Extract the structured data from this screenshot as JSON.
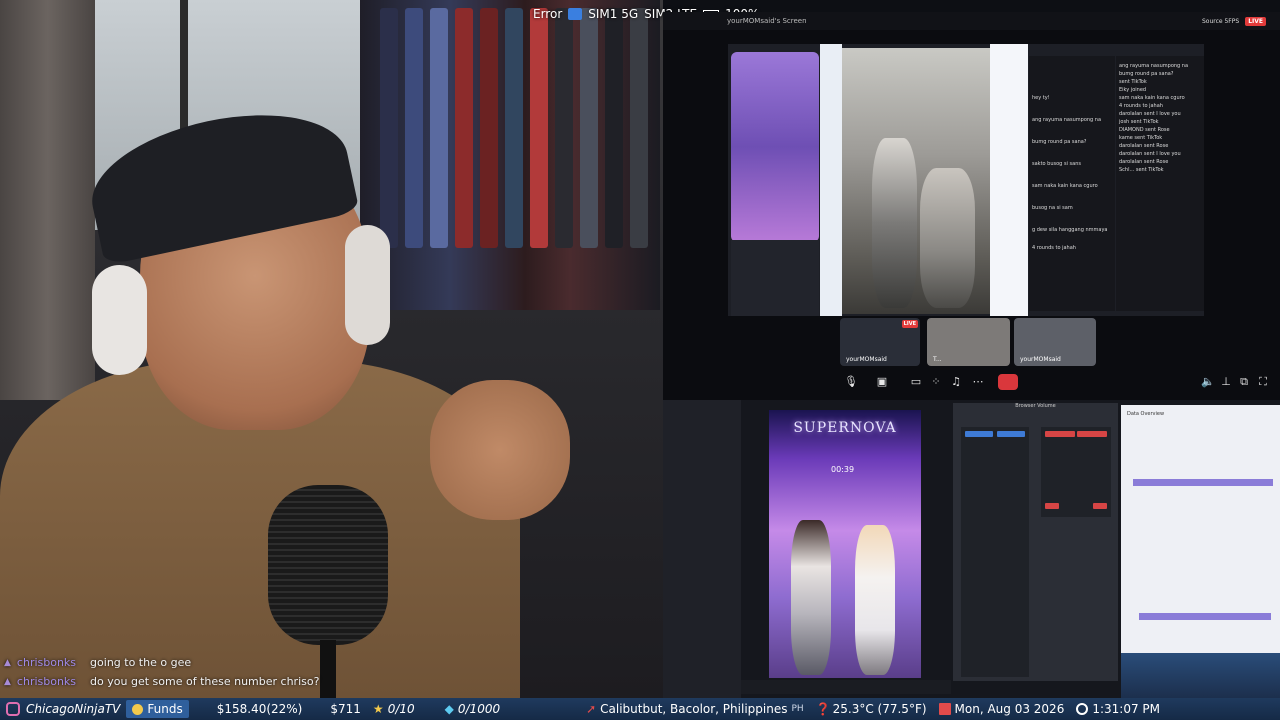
{
  "status_bar": {
    "error": "Error",
    "sim1": "SIM1 5G",
    "sim2": "SIM2 LTE",
    "battery": "100%"
  },
  "discord": {
    "screen_owner": "yourMOMsaid's Screen",
    "source_badge": "Source 5FPS",
    "live_badge": "LIVE",
    "tiles": [
      {
        "label": "yourMOMsaid",
        "live": "LIVE"
      },
      {
        "label": "T..."
      },
      {
        "label": "yourMOMsaid"
      }
    ],
    "chat_left": [
      "hey ty!",
      "ang rayuma nasumpong na",
      "bumg round pa sana?",
      "sakto busog si sans",
      "sam naka kain kana cguro",
      "busog na si sam",
      "g dew sila hanggang nmmaya",
      "4 rounds to jahah"
    ],
    "chat_right": [
      "ang rayuma nasumpong na",
      "bumg round pa sana?",
      "sent TikTok",
      "Eiky joined",
      "sam naka kain kana cguro",
      "4 rounds to jahah",
      "darolalan sent I love you",
      "josh sent TikTok",
      "DIAMOND sent Rose",
      "kame sent TikTok",
      "darolalan sent Rose",
      "darolalan sent I love you",
      "darolalan sent Rose",
      "Schl... sent TikTok"
    ]
  },
  "obs": {
    "supernova_title": "SUPERNOVA",
    "timer": "00:39",
    "volume_title": "Browser Volume",
    "dashboard_title": "Data Overview"
  },
  "chat": [
    {
      "user": "chrisbonks",
      "message": "going to the o gee"
    },
    {
      "user": "chrisbonks",
      "message": "do you get some of these number chriso?"
    }
  ],
  "ticker": {
    "channel": "ChicagoNinjaTV",
    "funds_label": "Funds",
    "funds_value": "$158.40(22%)",
    "amount": "$711",
    "stars": "0/10",
    "diamonds": "0/1000",
    "location": "Calibutbut, Bacolor, Philippines",
    "country": "PH",
    "temperature": "25.3°C (77.5°F)",
    "date": "Mon, Aug 03 2026",
    "time": "1:31:07 PM"
  }
}
